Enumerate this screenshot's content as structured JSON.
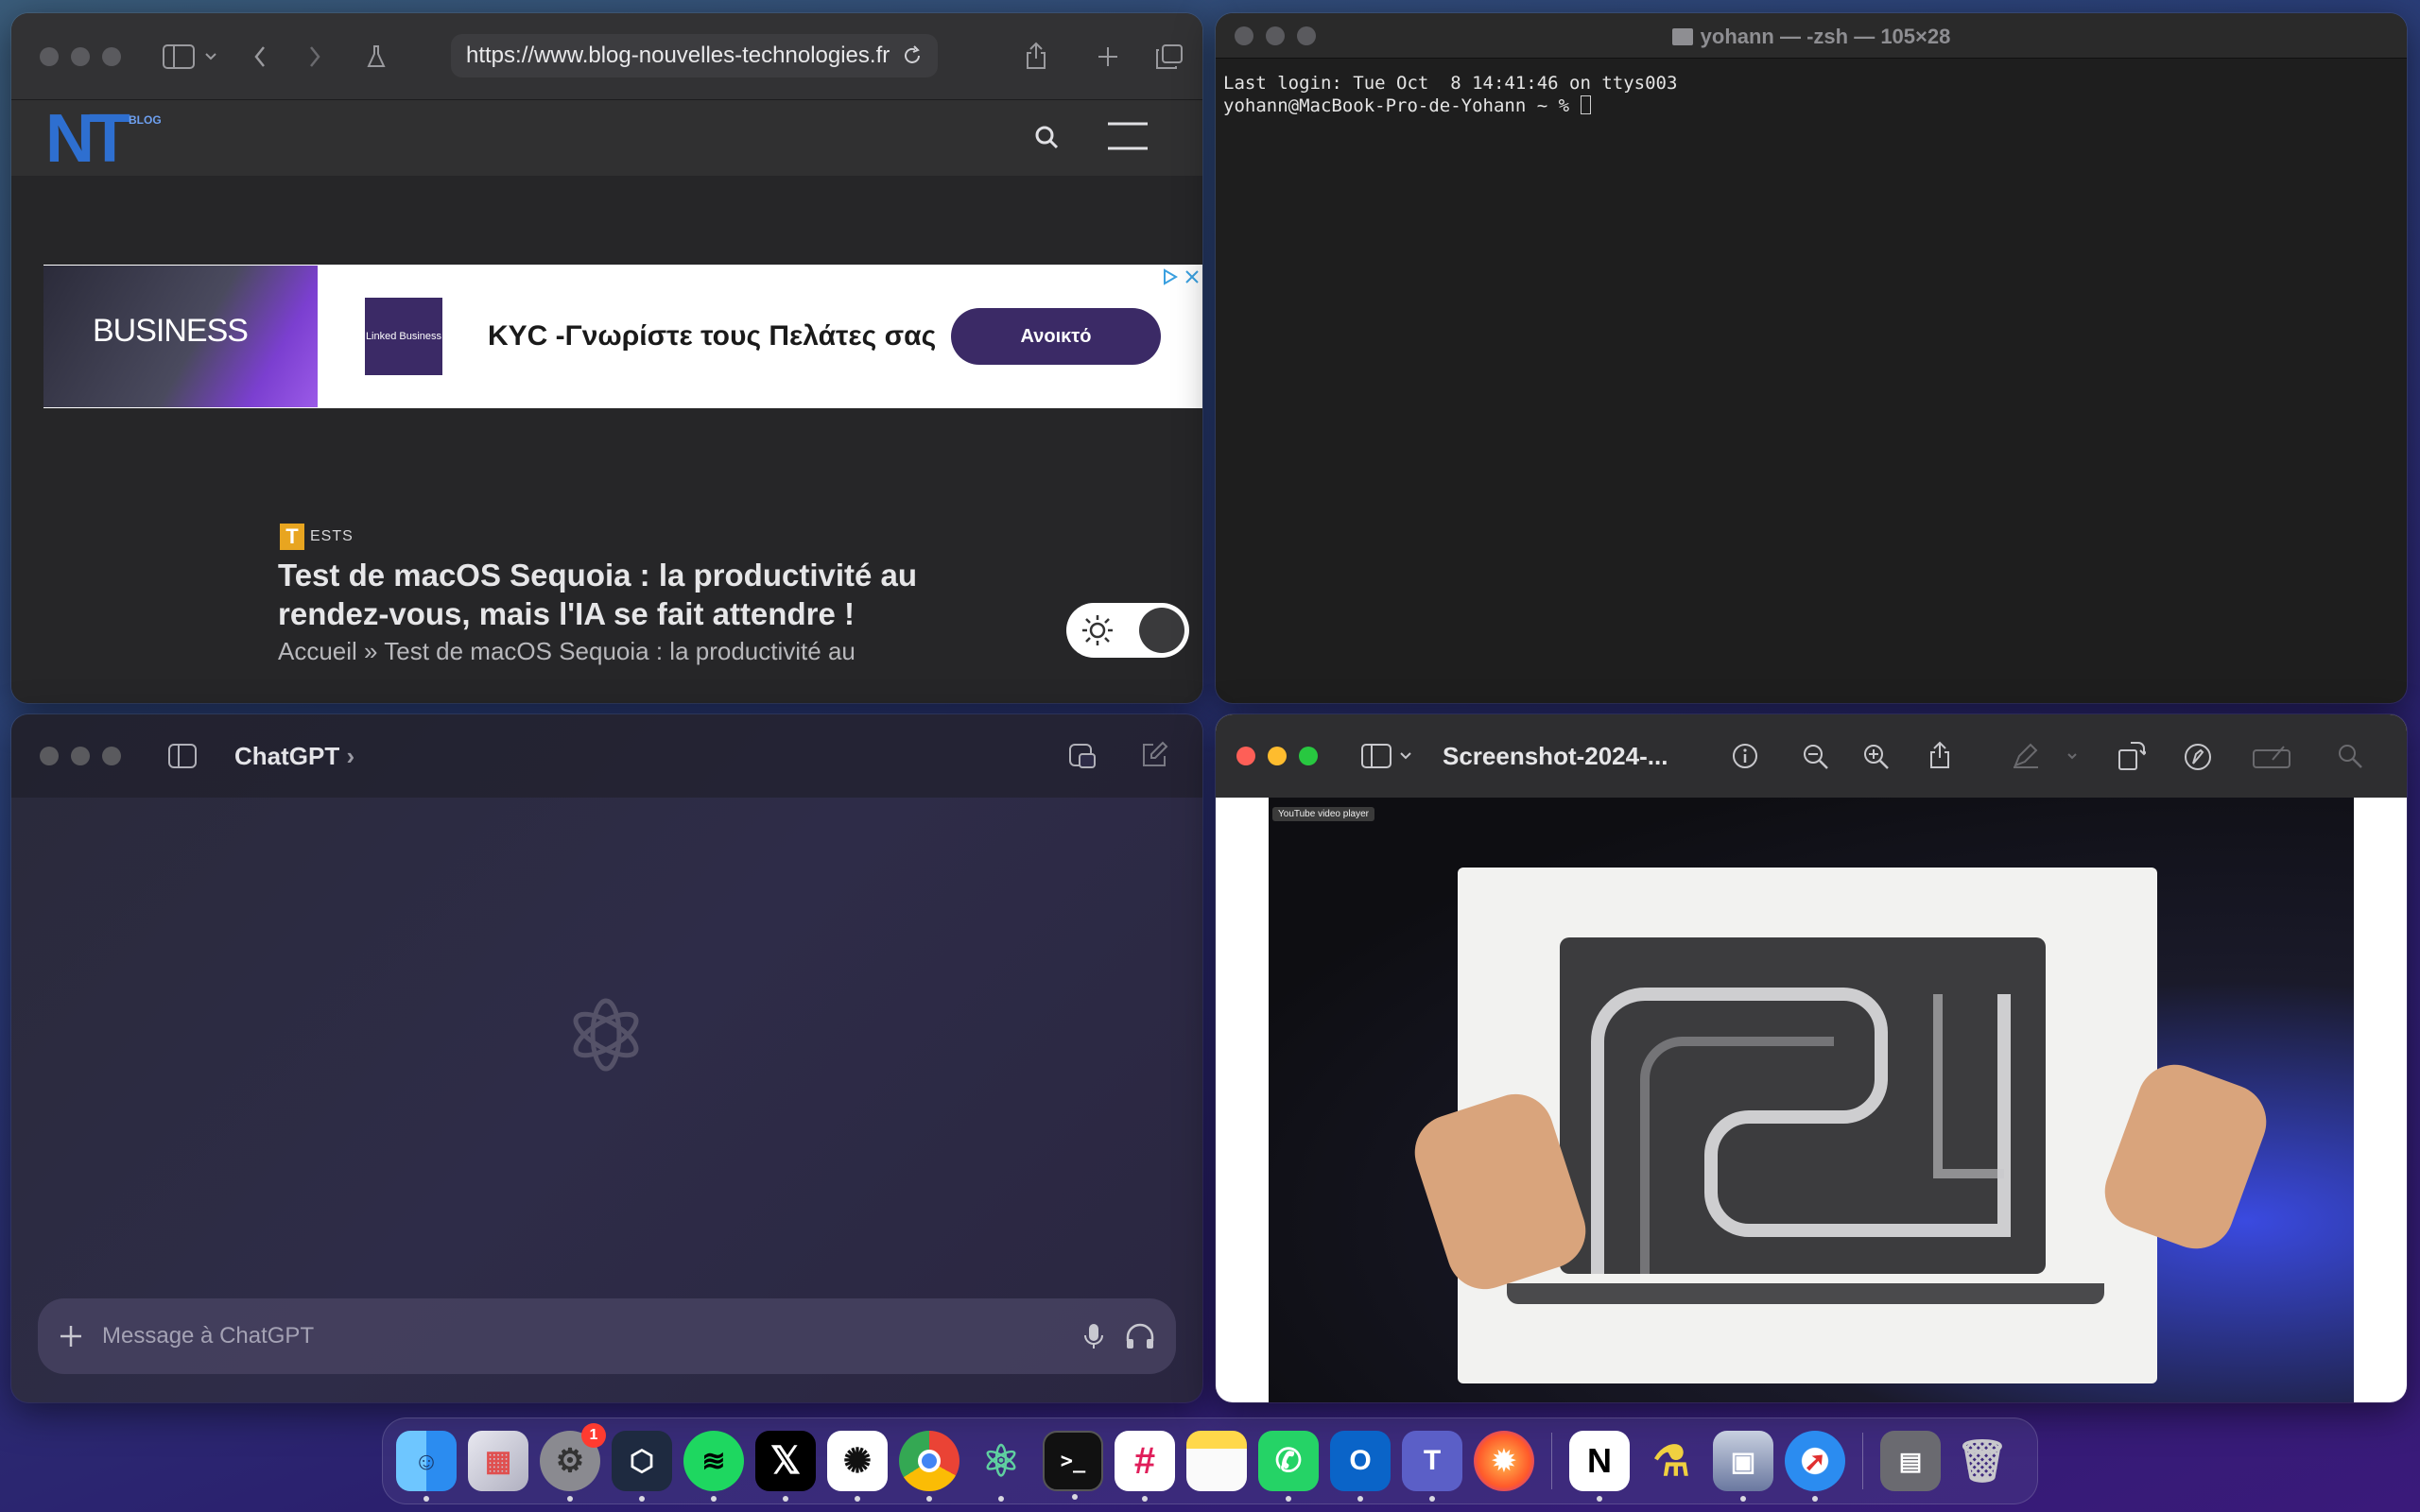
{
  "safari": {
    "url": "https://www.blog-nouvelles-technologies.fr",
    "logo_text": "NT",
    "logo_sup": "BLOG",
    "ad": {
      "img_text": "BUSINESS",
      "logo_text": "Linked Business",
      "title": "KYC -Γνωρίστε τους Πελάτες σας",
      "button": "Ανοικτό"
    },
    "category_initial": "T",
    "category_rest": "ESTS",
    "article_title": "Test de macOS Sequoia : la productivité au rendez-vous, mais l'IA se fait attendre !",
    "breadcrumb": "Accueil » Test de macOS Sequoia : la productivité au"
  },
  "terminal": {
    "title": "yohann — -zsh — 105×28",
    "line1": "Last login: Tue Oct  8 14:41:46 on ttys003",
    "prompt": "yohann@MacBook-Pro-de-Yohann ~ % "
  },
  "chatgpt": {
    "title": "ChatGPT",
    "placeholder": "Message à ChatGPT"
  },
  "preview": {
    "title": "Screenshot-2024-...",
    "tag": "YouTube video player"
  },
  "dock": {
    "apps": [
      "Finder",
      "Launchpad",
      "System Settings",
      "Xcode Cloud",
      "Spotify",
      "X",
      "ChatGPT",
      "Chrome",
      "Atom",
      "Terminal",
      "Slack",
      "Notes",
      "WhatsApp",
      "Outlook",
      "Teams",
      "Firefox",
      "Notion",
      "Flask",
      "Preview",
      "Safari",
      "Downloads",
      "Trash"
    ],
    "settings_badge": "1"
  }
}
